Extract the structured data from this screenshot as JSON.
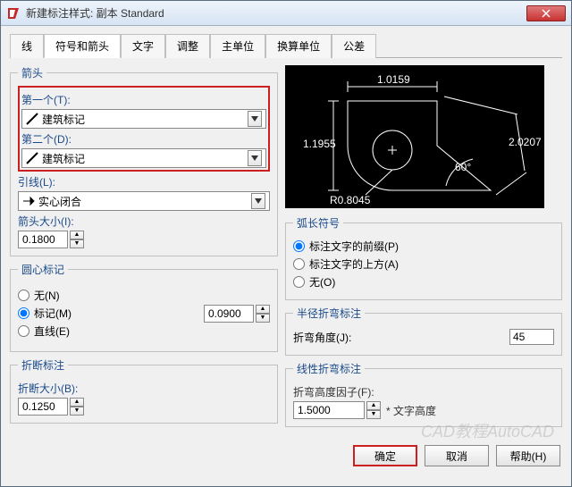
{
  "window": {
    "title": "新建标注样式: 副本 Standard"
  },
  "tabs": [
    "线",
    "符号和箭头",
    "文字",
    "调整",
    "主单位",
    "换算单位",
    "公差"
  ],
  "active_tab": 1,
  "arrowheads": {
    "legend": "箭头",
    "first_label": "第一个(T):",
    "first_value": "建筑标记",
    "second_label": "第二个(D):",
    "second_value": "建筑标记",
    "leader_label": "引线(L):",
    "leader_value": "实心闭合",
    "size_label": "箭头大小(I):",
    "size_value": "0.1800"
  },
  "center_marks": {
    "legend": "圆心标记",
    "none": "无(N)",
    "mark": "标记(M)",
    "line": "直线(E)",
    "value": "0.0900"
  },
  "dim_break": {
    "legend": "折断标注",
    "size_label": "折断大小(B):",
    "size_value": "0.1250"
  },
  "arc": {
    "legend": "弧长符号",
    "opt1": "标注文字的前缀(P)",
    "opt2": "标注文字的上方(A)",
    "opt3": "无(O)"
  },
  "radius_jog": {
    "legend": "半径折弯标注",
    "angle_label": "折弯角度(J):",
    "angle_value": "45"
  },
  "linear_jog": {
    "legend": "线性折弯标注",
    "height_label": "折弯高度因子(F):",
    "height_value": "1.5000",
    "suffix": "* 文字高度"
  },
  "preview": {
    "d1": "1.0159",
    "d2": "1.1955",
    "d3": "2.0207",
    "ang": "60°",
    "rad": "R0.8045"
  },
  "buttons": {
    "ok": "确定",
    "cancel": "取消",
    "help": "帮助(H)"
  },
  "watermark": "CAD教程AutoCAD"
}
